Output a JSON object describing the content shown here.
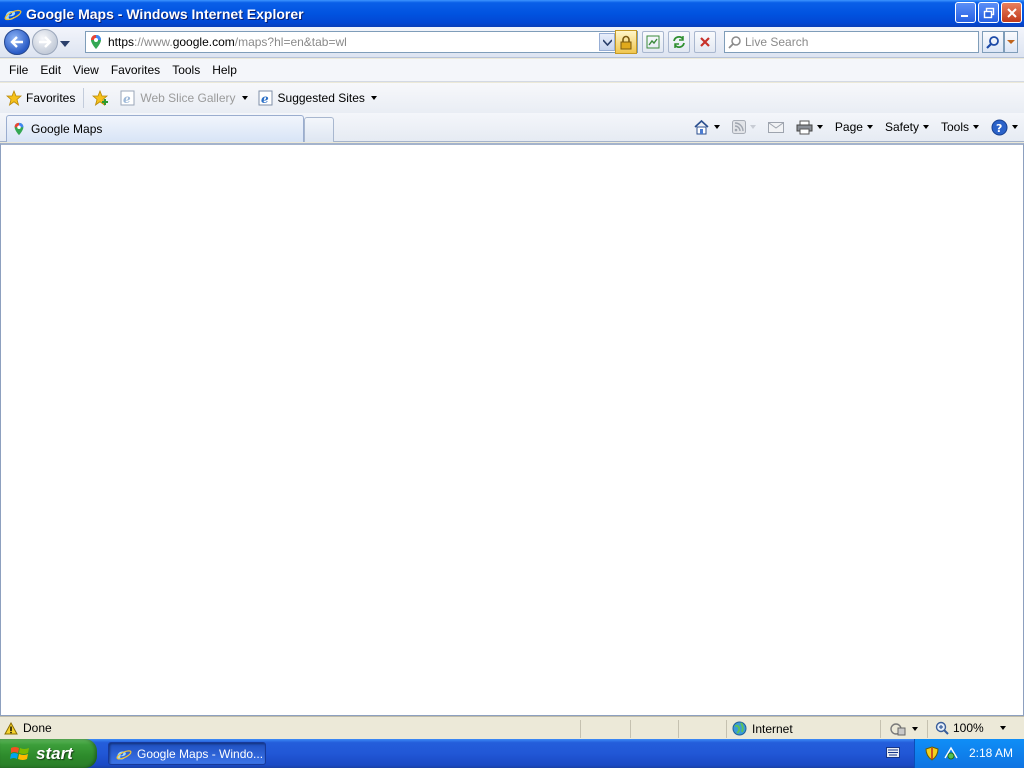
{
  "window": {
    "title": "Google Maps - Windows Internet Explorer"
  },
  "address": {
    "scheme": "https",
    "scheme_sep": "://",
    "subdomain": "www.",
    "host": "google.com",
    "path": "/maps?hl=en&tab=wl"
  },
  "search": {
    "placeholder": "Live Search"
  },
  "menu": {
    "items": [
      "File",
      "Edit",
      "View",
      "Favorites",
      "Tools",
      "Help"
    ]
  },
  "favorites_bar": {
    "favorites_label": "Favorites",
    "web_slice_label": "Web Slice Gallery",
    "suggested_label": "Suggested Sites"
  },
  "tabs": {
    "active_label": "Google Maps"
  },
  "command_bar": {
    "page_label": "Page",
    "safety_label": "Safety",
    "tools_label": "Tools"
  },
  "status": {
    "text": "Done",
    "zone": "Internet",
    "zoom": "100%"
  },
  "taskbar": {
    "start_label": "start",
    "task_label": "Google Maps - Windo...",
    "clock": "2:18 AM"
  },
  "colors": {
    "titlebar": "#0153e0",
    "taskbar": "#245edb",
    "start": "#3c9e3a",
    "tray": "#0f8ef7"
  }
}
